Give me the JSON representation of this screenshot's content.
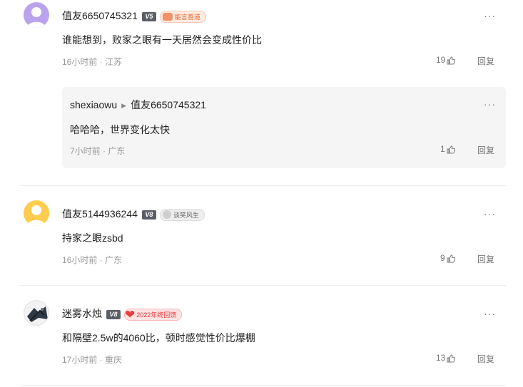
{
  "comments": [
    {
      "username": "值友6650745321",
      "level_badge": "V5",
      "medal": "能言善道",
      "text": "谁能想到，败家之眼有一天居然会变成性价比",
      "meta": "16小时前 · 江苏",
      "likes": "19",
      "reply_label": "回复",
      "more_label": "···",
      "sub_reply": {
        "username": "shexiaowu",
        "reply_to": "值友6650745321",
        "text": "哈哈哈，世界变化太快",
        "meta": "7小时前 · 广东",
        "likes": "1",
        "reply_label": "回复",
        "more_label": "···"
      }
    },
    {
      "username": "值友5144936244",
      "level_badge": "V8",
      "medal": "谈笑风生",
      "text": "持家之眼zsbd",
      "meta": "16小时前 · 广东",
      "likes": "9",
      "reply_label": "回复",
      "more_label": "···"
    },
    {
      "username": "迷雾水烛",
      "level_badge": "V8",
      "medal": "2022年终回馈",
      "text": "和隔壁2.5w的4060比，顿时感觉性价比爆棚",
      "meta": "17小时前 · 重庆",
      "likes": "13",
      "reply_label": "回复",
      "more_label": "···"
    }
  ],
  "colors": {
    "link_gray": "#777777",
    "meta_gray": "#999999",
    "medal_orange": "#e4632b",
    "medal_red": "#e8343a",
    "level_badge": "#5a5e66",
    "sub_bg": "#f5f5f5"
  },
  "icons": [
    "thumb-up-icon",
    "more-icon",
    "heart-icon",
    "arrow-right-icon"
  ]
}
